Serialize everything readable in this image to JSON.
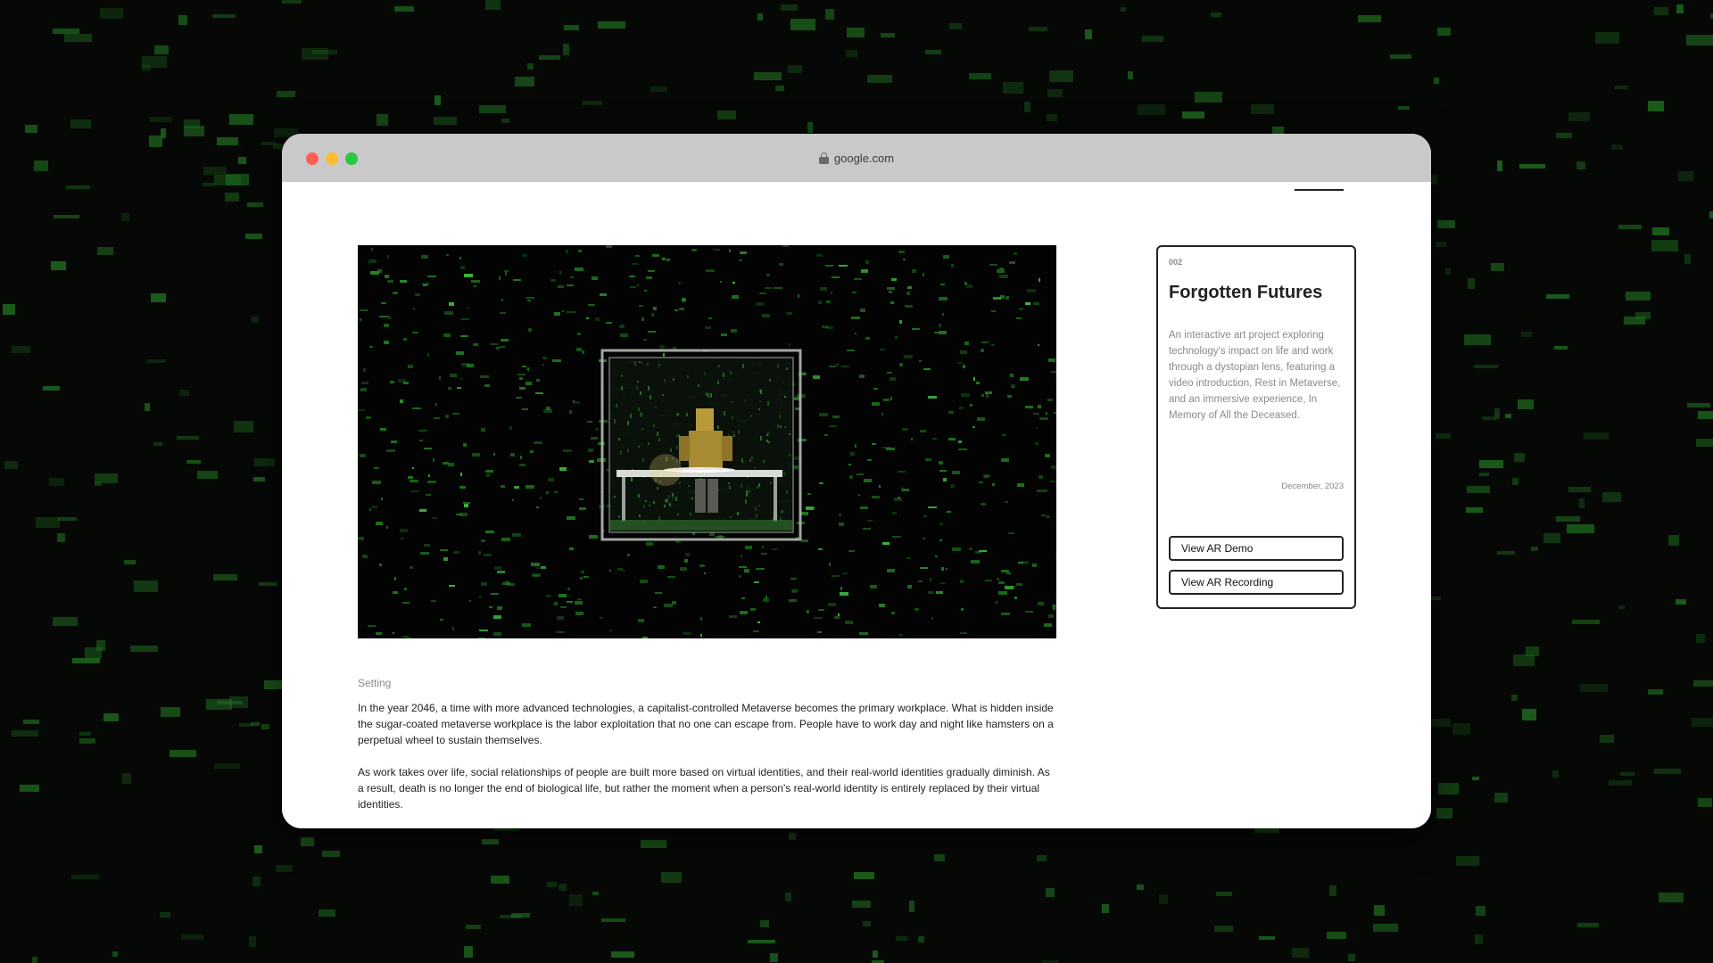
{
  "browser": {
    "url": "google.com"
  },
  "project": {
    "number": "002",
    "title": "Forgotten Futures",
    "description": "An interactive art project exploring technology's impact on life and work through a dystopian lens, featuring a video introduction, Rest in Metaverse, and an immersive experience, In Memory of All the Deceased.",
    "date": "December, 2023",
    "buttons": {
      "demo": "View AR Demo",
      "recording": "View AR Recording"
    }
  },
  "article": {
    "section_label": "Setting",
    "paragraphs": [
      "In the year 2046, a time with more advanced technologies, a capitalist-controlled Metaverse becomes the primary workplace. What is hidden inside the sugar-coated metaverse workplace is the labor exploitation that no one can escape from. People have to work day and night like hamsters on a perpetual wheel to sustain themselves.",
      "As work takes over life, social relationships of people are built more based on virtual identities, and their real-world identities gradually diminish. As a result, death is no longer the end of biological life, but rather the moment when a person's real-world identity is entirely replaced by their virtual identities."
    ]
  },
  "colors": {
    "background": "#060806",
    "matrix_green": "#1f6b1f",
    "titlebar": "#c9c9c9",
    "traffic_red": "#ff5f57",
    "traffic_yellow": "#febc2e",
    "traffic_green": "#28c840"
  },
  "icons": {
    "lock": "lock-icon"
  }
}
